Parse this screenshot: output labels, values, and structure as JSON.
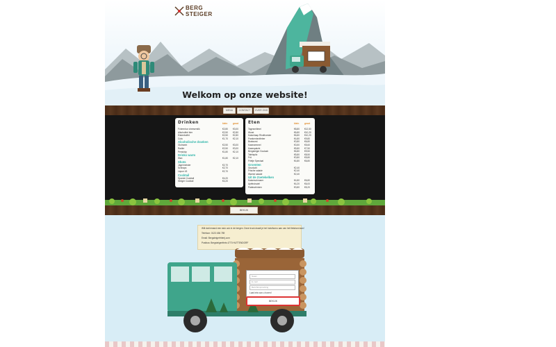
{
  "brand": {
    "line1": "BERG",
    "line2": "STEIGER"
  },
  "hero": {
    "welcome": "Welkom op onze website!"
  },
  "nav": {
    "items": [
      "MENU",
      "CONTACT",
      "OVER ONS"
    ]
  },
  "menu_drinks": {
    "title": "Drinken",
    "col1": "klein",
    "col2": "groot",
    "rows": [
      {
        "name": "Fohrenbur cheesemilk",
        "a": "€2,80",
        "b": "€3,00"
      },
      {
        "name": "Alkoholfrei bier",
        "a": "€2,50",
        "b": "€2,80"
      },
      {
        "name": "Eisteebuffet",
        "a": "€2,50",
        "b": "€2,80"
      },
      {
        "name": "Cola",
        "a": "€1,70",
        "b": "€2,10"
      }
    ],
    "sec1": "Alcoholische dranken",
    "rows1": [
      {
        "name": "Gluhwein",
        "a": "€2,50",
        "b": "€3,00"
      },
      {
        "name": "Radler",
        "a": "€2,50",
        "b": "€3,00"
      },
      {
        "name": "Pensicky",
        "a": "€1,80",
        "b": "€2,10"
      }
    ],
    "sec2": "Drinks warm",
    "rows2": [
      {
        "name": "Wan",
        "a": "€1,80",
        "b": "€2,10"
      }
    ],
    "sec3": "Shots",
    "rows3": [
      {
        "name": "Jagermeister",
        "a": "€2,70",
        "b": ""
      },
      {
        "name": "Schnaps",
        "a": "€2,70",
        "b": ""
      },
      {
        "name": "Liquor 43",
        "a": "€2,70",
        "b": ""
      }
    ],
    "sec4": "Cocktail",
    "rows4": [
      {
        "name": "Sponde Cocktail",
        "a": "€4,20",
        "b": ""
      },
      {
        "name": "Steiger Cocktail",
        "a": "€4,20",
        "b": ""
      }
    ]
  },
  "menu_food": {
    "title": "Eten",
    "col1": "klein",
    "col2": "groot",
    "rows": [
      {
        "name": "Tagesmittmel",
        "a": "€8,80",
        "b": "€12,50"
      },
      {
        "name": "Wurst",
        "a": "€6,80",
        "b": "€10,20"
      },
      {
        "name": "Kaiserlaap Rindfroester",
        "a": "€6,80",
        "b": "€10,20"
      },
      {
        "name": "Frankenbrotfeber",
        "a": "€4,80",
        "b": "€9,80"
      },
      {
        "name": "Bratwurst",
        "a": "€3,80",
        "b": "€6,80"
      },
      {
        "name": "Kasesemmel",
        "a": "€3,50",
        "b": "€5,60"
      },
      {
        "name": "Kasespatzle",
        "a": "€5,80",
        "b": "€7,50"
      },
      {
        "name": "Bergsteiger Goulash",
        "a": "€6,80",
        "b": "€9,50"
      },
      {
        "name": "Tafelspitz",
        "a": "€5,80",
        "b": "€8,50"
      },
      {
        "name": "Frit",
        "a": "€3,80",
        "b": "€5,80"
      },
      {
        "name": "Frietje Speciaal",
        "a": "€4,80",
        "b": "€6,80"
      }
    ],
    "sec1": "Groenten",
    "rows1": [
      {
        "name": "Grunkohl",
        "a": "€2,40",
        "b": ""
      },
      {
        "name": "Frische salade",
        "a": "€2,40",
        "b": ""
      },
      {
        "name": "Warme salade",
        "a": "€2,40",
        "b": ""
      }
    ],
    "sec2": "Uit de Zoetekelken",
    "rows2": [
      {
        "name": "Kaiserschmarrn",
        "a": "€4,80",
        "b": "€6,80"
      },
      {
        "name": "Apfelstrudel",
        "a": "€4,20",
        "b": "€6,00"
      },
      {
        "name": "Palatschinken",
        "a": "€3,80",
        "b": "€5,20"
      }
    ]
  },
  "board": {
    "button": "BEKIJK"
  },
  "contact": {
    "lines": [
      "Wilt dat iemand een stuk ook in de bergen. Deze truck draait je het hulsthorno aan van het fietsbord aan!",
      "Telefoon: 0123 456 789",
      "Email: Bergsteigerfriterij.com",
      "Postbus: Bergsteigerfriets 4770 HUTTENDORF"
    ],
    "form": {
      "name_placeholder": "Naam",
      "email_placeholder": "E-mail",
      "msg_placeholder": "Bericht/opmerking",
      "text": "Laat iets van u horen!",
      "send": "BEKIJK"
    }
  }
}
